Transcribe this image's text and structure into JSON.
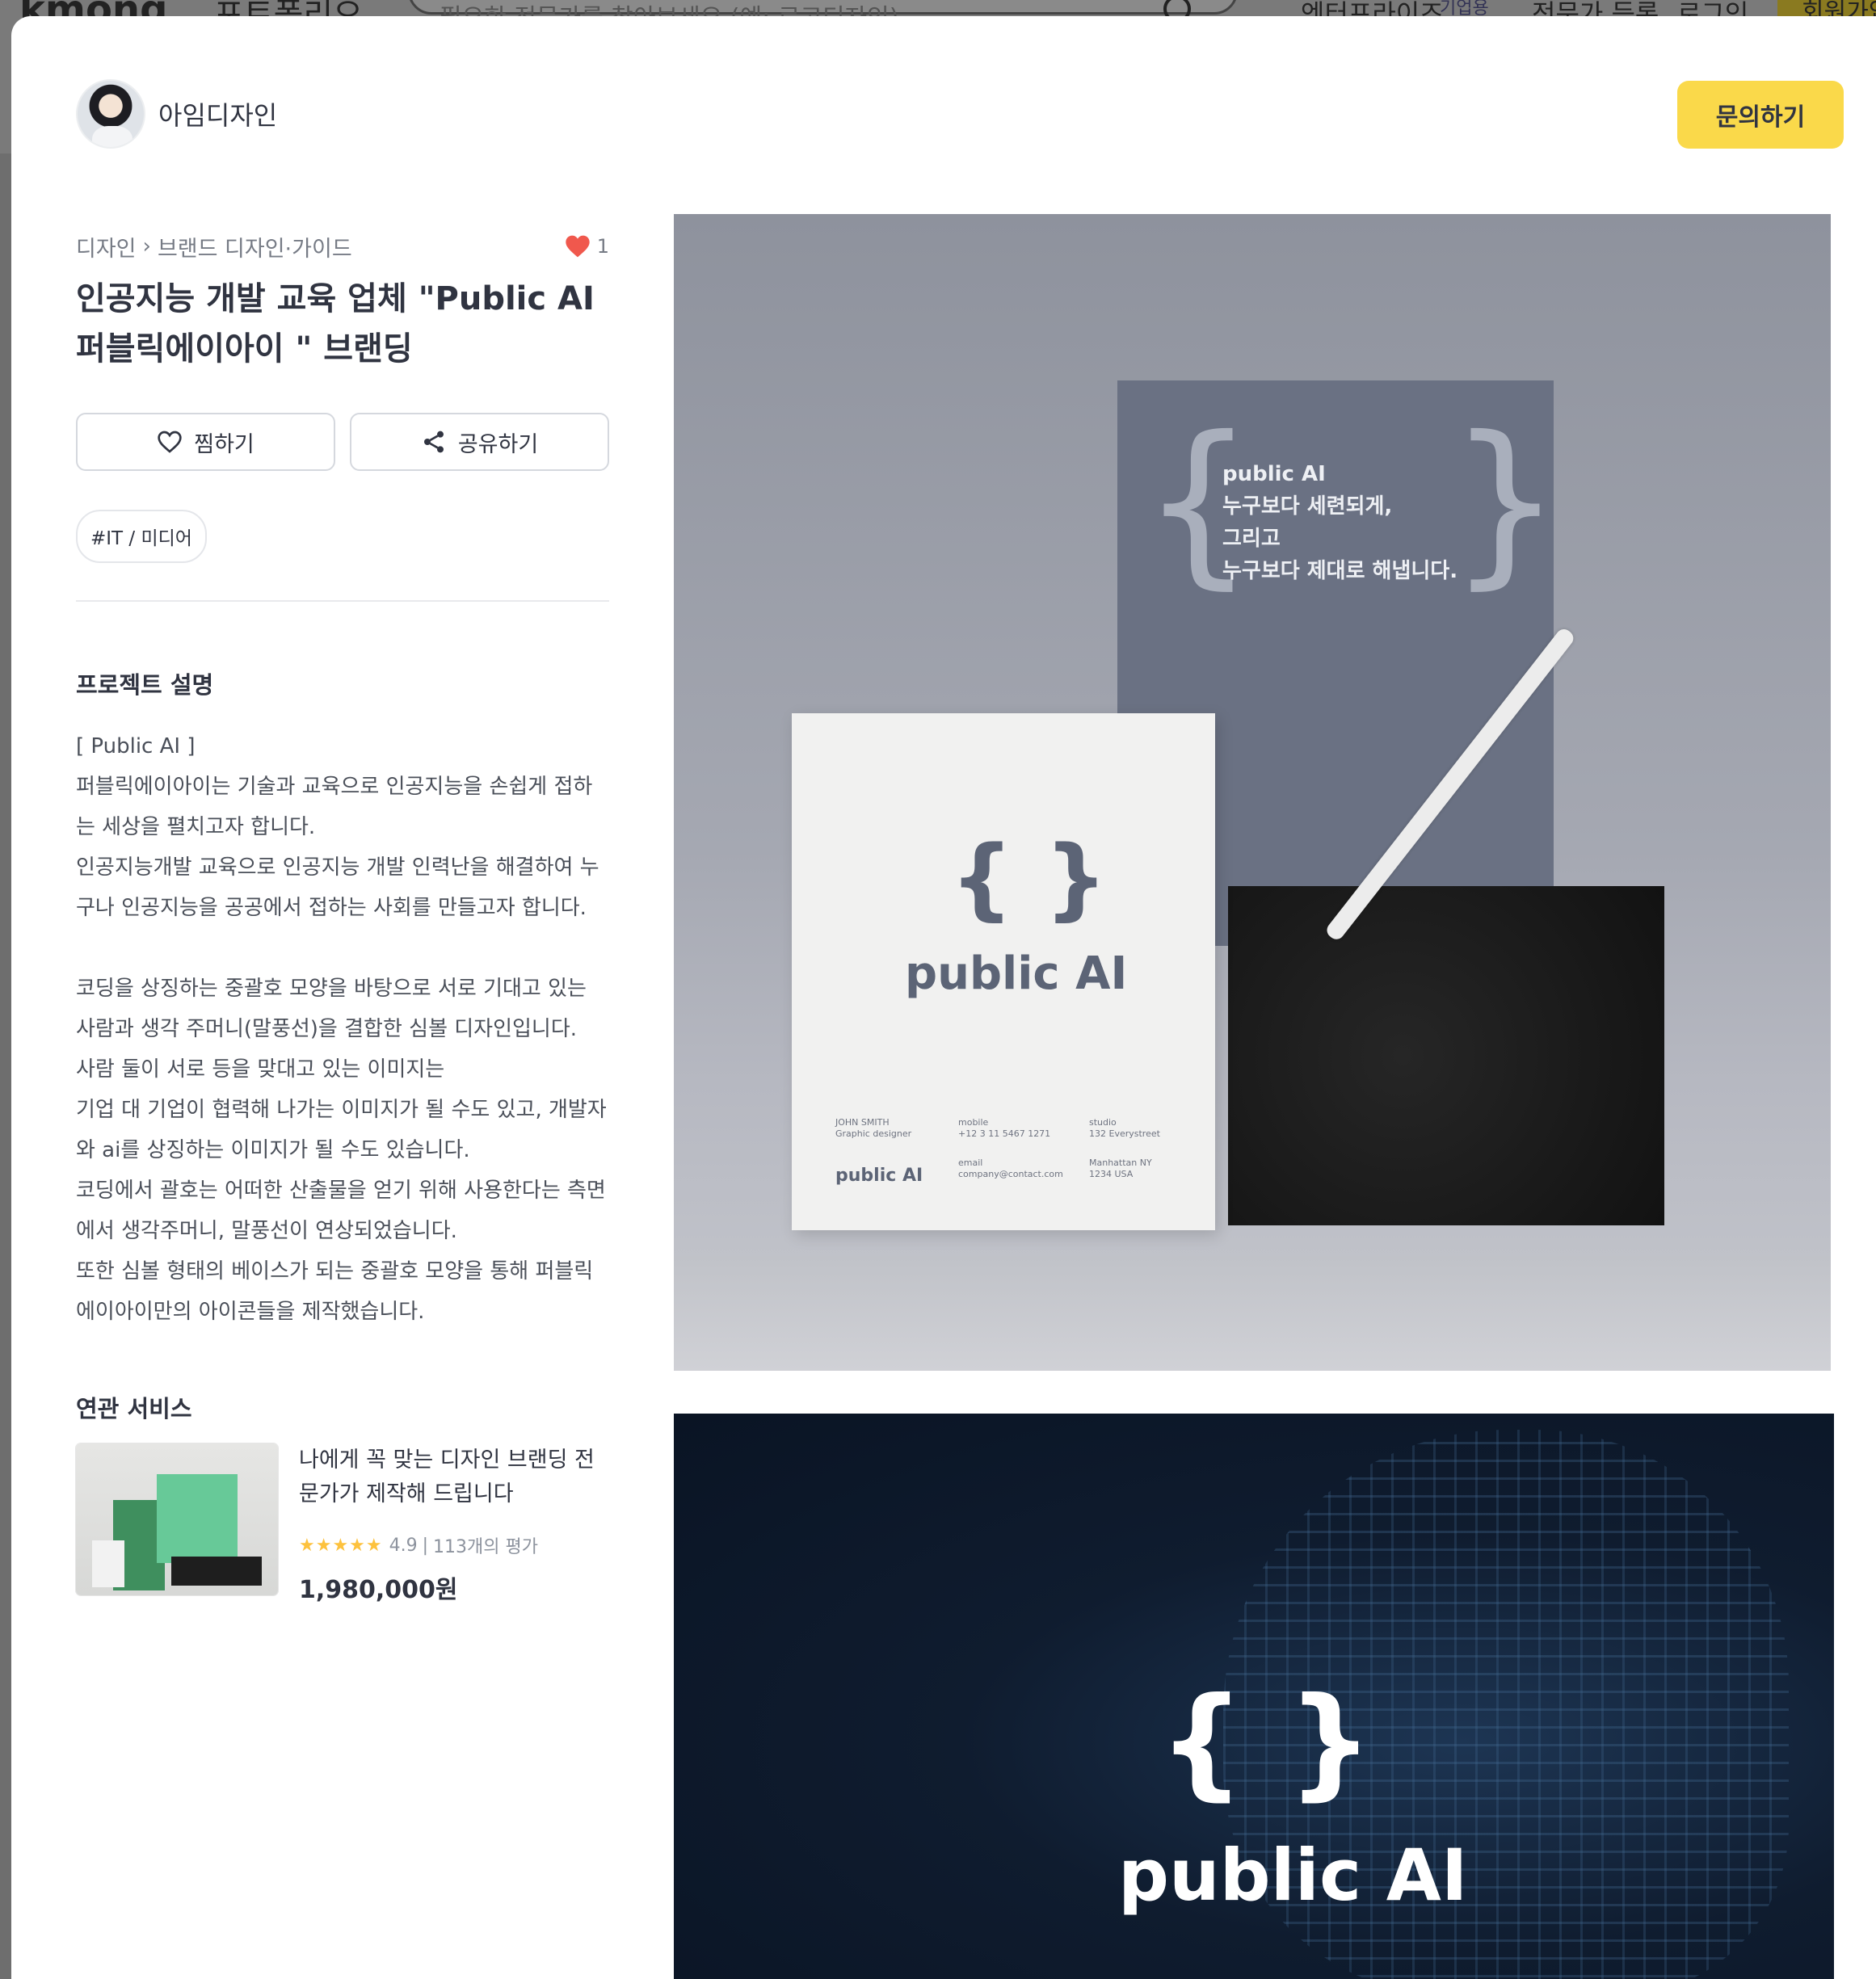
{
  "background_header": {
    "logo": "kmong",
    "nav_label": "포트폴리오",
    "search_placeholder": "필요한 전문가를 찾아보세요 (예: 로고디자인)",
    "links": [
      "엔터프라이즈",
      "기업용",
      "전문가 등록",
      "로그인"
    ],
    "signup_label": "회원가입"
  },
  "author": {
    "name": "아임디자인"
  },
  "inquiry_button": "문의하기",
  "breadcrumb": {
    "category": "디자인",
    "subcategory": "브랜드 디자인·가이드"
  },
  "like_count": "1",
  "title": "인공지능 개발 교육 업체 \"Public AI 퍼블릭에이아이 \" 브랜딩",
  "actions": {
    "wishlist_label": "찜하기",
    "share_label": "공유하기"
  },
  "tag": "#IT / 미디어",
  "project_description": {
    "heading": "프로젝트 설명",
    "body": "[ Public AI ]\n퍼블릭에이아이는 기술과 교육으로 인공지능을 손쉽게 접하는 세상을 펼치고자 합니다.\n인공지능개발 교육으로 인공지능 개발 인력난을 해결하여 누구나 인공지능을 공공에서 접하는 사회를 만들고자 합니다.\n\n코딩을 상징하는 중괄호 모양을 바탕으로 서로 기대고 있는 사람과 생각 주머니(말풍선)을 결합한 심볼 디자인입니다.\n사람 둘이 서로 등을 맞대고 있는 이미지는\n기업 대 기업이 협력해 나가는 이미지가 될 수도 있고, 개발자와 ai를 상징하는 이미지가 될 수도 있습니다.\n코딩에서 괄호는 어떠한 산출물을 얻기 위해 사용한다는 측면에서 생각주머니, 말풍선이 연상되었습니다.\n또한 심볼 형태의 베이스가 되는 중괄호 모양을 통해 퍼블릭에이아이만의 아이콘들을 제작했습니다."
  },
  "related_services": {
    "heading": "연관 서비스",
    "items": [
      {
        "name": "나에게 꼭 맞는 디자인 브랜딩 전문가가 제작해 드립니다",
        "rating": "4.9",
        "reviews": "113개의 평가",
        "price": "1,980,000원"
      }
    ]
  },
  "portfolio_images": {
    "image1": {
      "back_card_text": "public AI\n누구보다 세련되게,\n그리고\n누구보다 제대로 해냅니다.",
      "front_card_brand": "public AI",
      "front_card_name": "JOHN SMITH\nGraphic designer",
      "front_card_mobile": "mobile\n+12 3 11 5467 1271",
      "front_card_email": "email\ncompany@contact.com",
      "front_card_studio": "studio\n132 Everystreet",
      "front_card_city": "Manhattan  NY\n1234 USA",
      "front_card_brand_small": "public AI"
    },
    "image2": {
      "brand": "public AI"
    }
  },
  "colors": {
    "accent": "#fad94a",
    "heart": "#f0584d",
    "star": "#fdc23e"
  }
}
